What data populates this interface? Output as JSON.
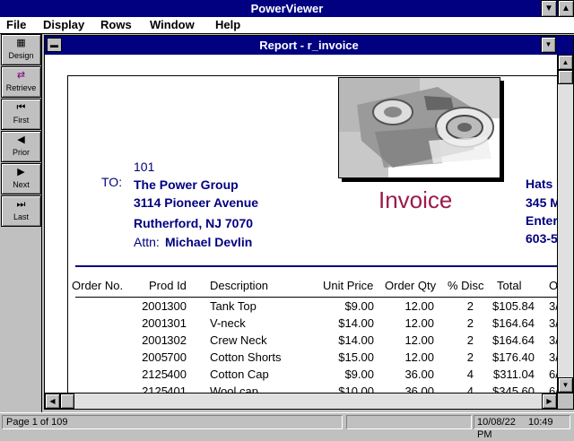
{
  "app": {
    "title": "PowerViewer"
  },
  "menu": [
    "File",
    "Display",
    "Rows",
    "Window",
    "Help"
  ],
  "toolbar": [
    {
      "label": "Design",
      "icon": "grid-icon",
      "glyph": "▦"
    },
    {
      "label": "Retrieve",
      "icon": "retrieve-icon",
      "glyph": "⇄"
    },
    {
      "label": "First",
      "icon": "first-icon",
      "glyph": "⏮"
    },
    {
      "label": "Prior",
      "icon": "prior-icon",
      "glyph": "◀"
    },
    {
      "label": "Next",
      "icon": "next-icon",
      "glyph": "▶"
    },
    {
      "label": "Last",
      "icon": "last-icon",
      "glyph": "⏭"
    }
  ],
  "child": {
    "title": "Report - r_invoice"
  },
  "report": {
    "to_label": "TO:",
    "customer_id": "101",
    "company": "The Power Group",
    "address1": "3114 Pioneer Avenue",
    "address2": "Rutherford,  NJ  7070",
    "attn_label": "Attn:",
    "attn_name": "Michael Devlin",
    "invoice_title": "Invoice",
    "right_block": [
      "Hats",
      "345 M",
      "Enter",
      "603-5"
    ],
    "columns": [
      "Order No.",
      "Prod Id",
      "Description",
      "Unit Price",
      "Order Qty",
      "% Disc",
      "Total",
      "O"
    ],
    "rows": [
      [
        "2001",
        "300",
        "Tank Top",
        "$9.00",
        "12.00",
        "2",
        "$105.84",
        "3/"
      ],
      [
        "2001",
        "301",
        "V-neck",
        "$14.00",
        "12.00",
        "2",
        "$164.64",
        "3/"
      ],
      [
        "2001",
        "302",
        "Crew Neck",
        "$14.00",
        "12.00",
        "2",
        "$164.64",
        "3/"
      ],
      [
        "2005",
        "700",
        "Cotton Shorts",
        "$15.00",
        "12.00",
        "2",
        "$176.40",
        "3/"
      ],
      [
        "2125",
        "400",
        "Cotton Cap",
        "$9.00",
        "36.00",
        "4",
        "$311.04",
        "6/"
      ],
      [
        "2125",
        "401",
        "Wool cap",
        "$10.00",
        "36.00",
        "4",
        "$345.60",
        "6/"
      ]
    ]
  },
  "status": {
    "page": "Page 1 of 109",
    "date": "10/08/22",
    "time": "10:49 PM"
  }
}
